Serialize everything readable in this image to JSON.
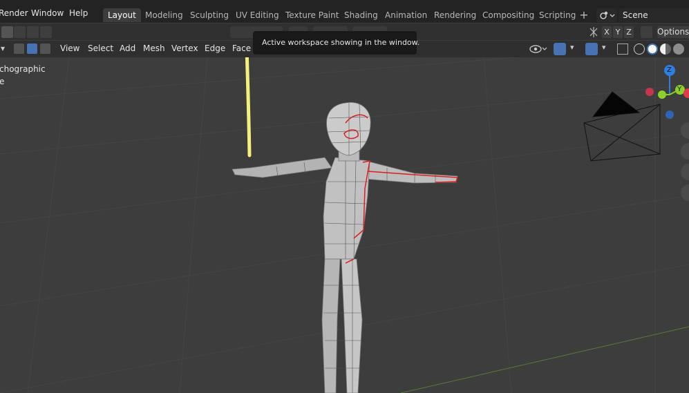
{
  "menu": {
    "render": "Render",
    "window": "Window",
    "help": "Help"
  },
  "workspaces": [
    {
      "label": "Layout",
      "active": true
    },
    {
      "label": "Modeling"
    },
    {
      "label": "Sculpting"
    },
    {
      "label": "UV Editing"
    },
    {
      "label": "Texture Paint"
    },
    {
      "label": "Shading"
    },
    {
      "label": "Animation"
    },
    {
      "label": "Rendering"
    },
    {
      "label": "Compositing"
    },
    {
      "label": "Scripting"
    }
  ],
  "add_workspace_symbol": "+",
  "scene": {
    "value": "Scene"
  },
  "toolbar": {
    "axis_x": "X",
    "axis_y": "Y",
    "axis_z": "Z",
    "options_label": "Options"
  },
  "view3d_header": {
    "view": "View",
    "select": "Select",
    "add": "Add",
    "mesh": "Mesh",
    "vertex": "Vertex",
    "edge": "Edge",
    "face": "Face"
  },
  "tooltip": {
    "text": "Active workspace showing in the window."
  },
  "viewport": {
    "projection_label": "chographic",
    "collection_label": "e"
  },
  "gizmo": {
    "z": "Z",
    "y": "Y"
  },
  "colors": {
    "accent": "#4772b3",
    "annotation": "#f5f07a",
    "seam": "#d81f1f",
    "axis_z": "#2f7fe0",
    "axis_y": "#8bd12a",
    "axis_x": "#e03a4e"
  },
  "icons": [
    "tool-select-icon",
    "camera-icon",
    "hand-icon",
    "zoom-icon",
    "grid-icon",
    "shading-solid-icon",
    "overlay-icon",
    "xray-icon"
  ]
}
